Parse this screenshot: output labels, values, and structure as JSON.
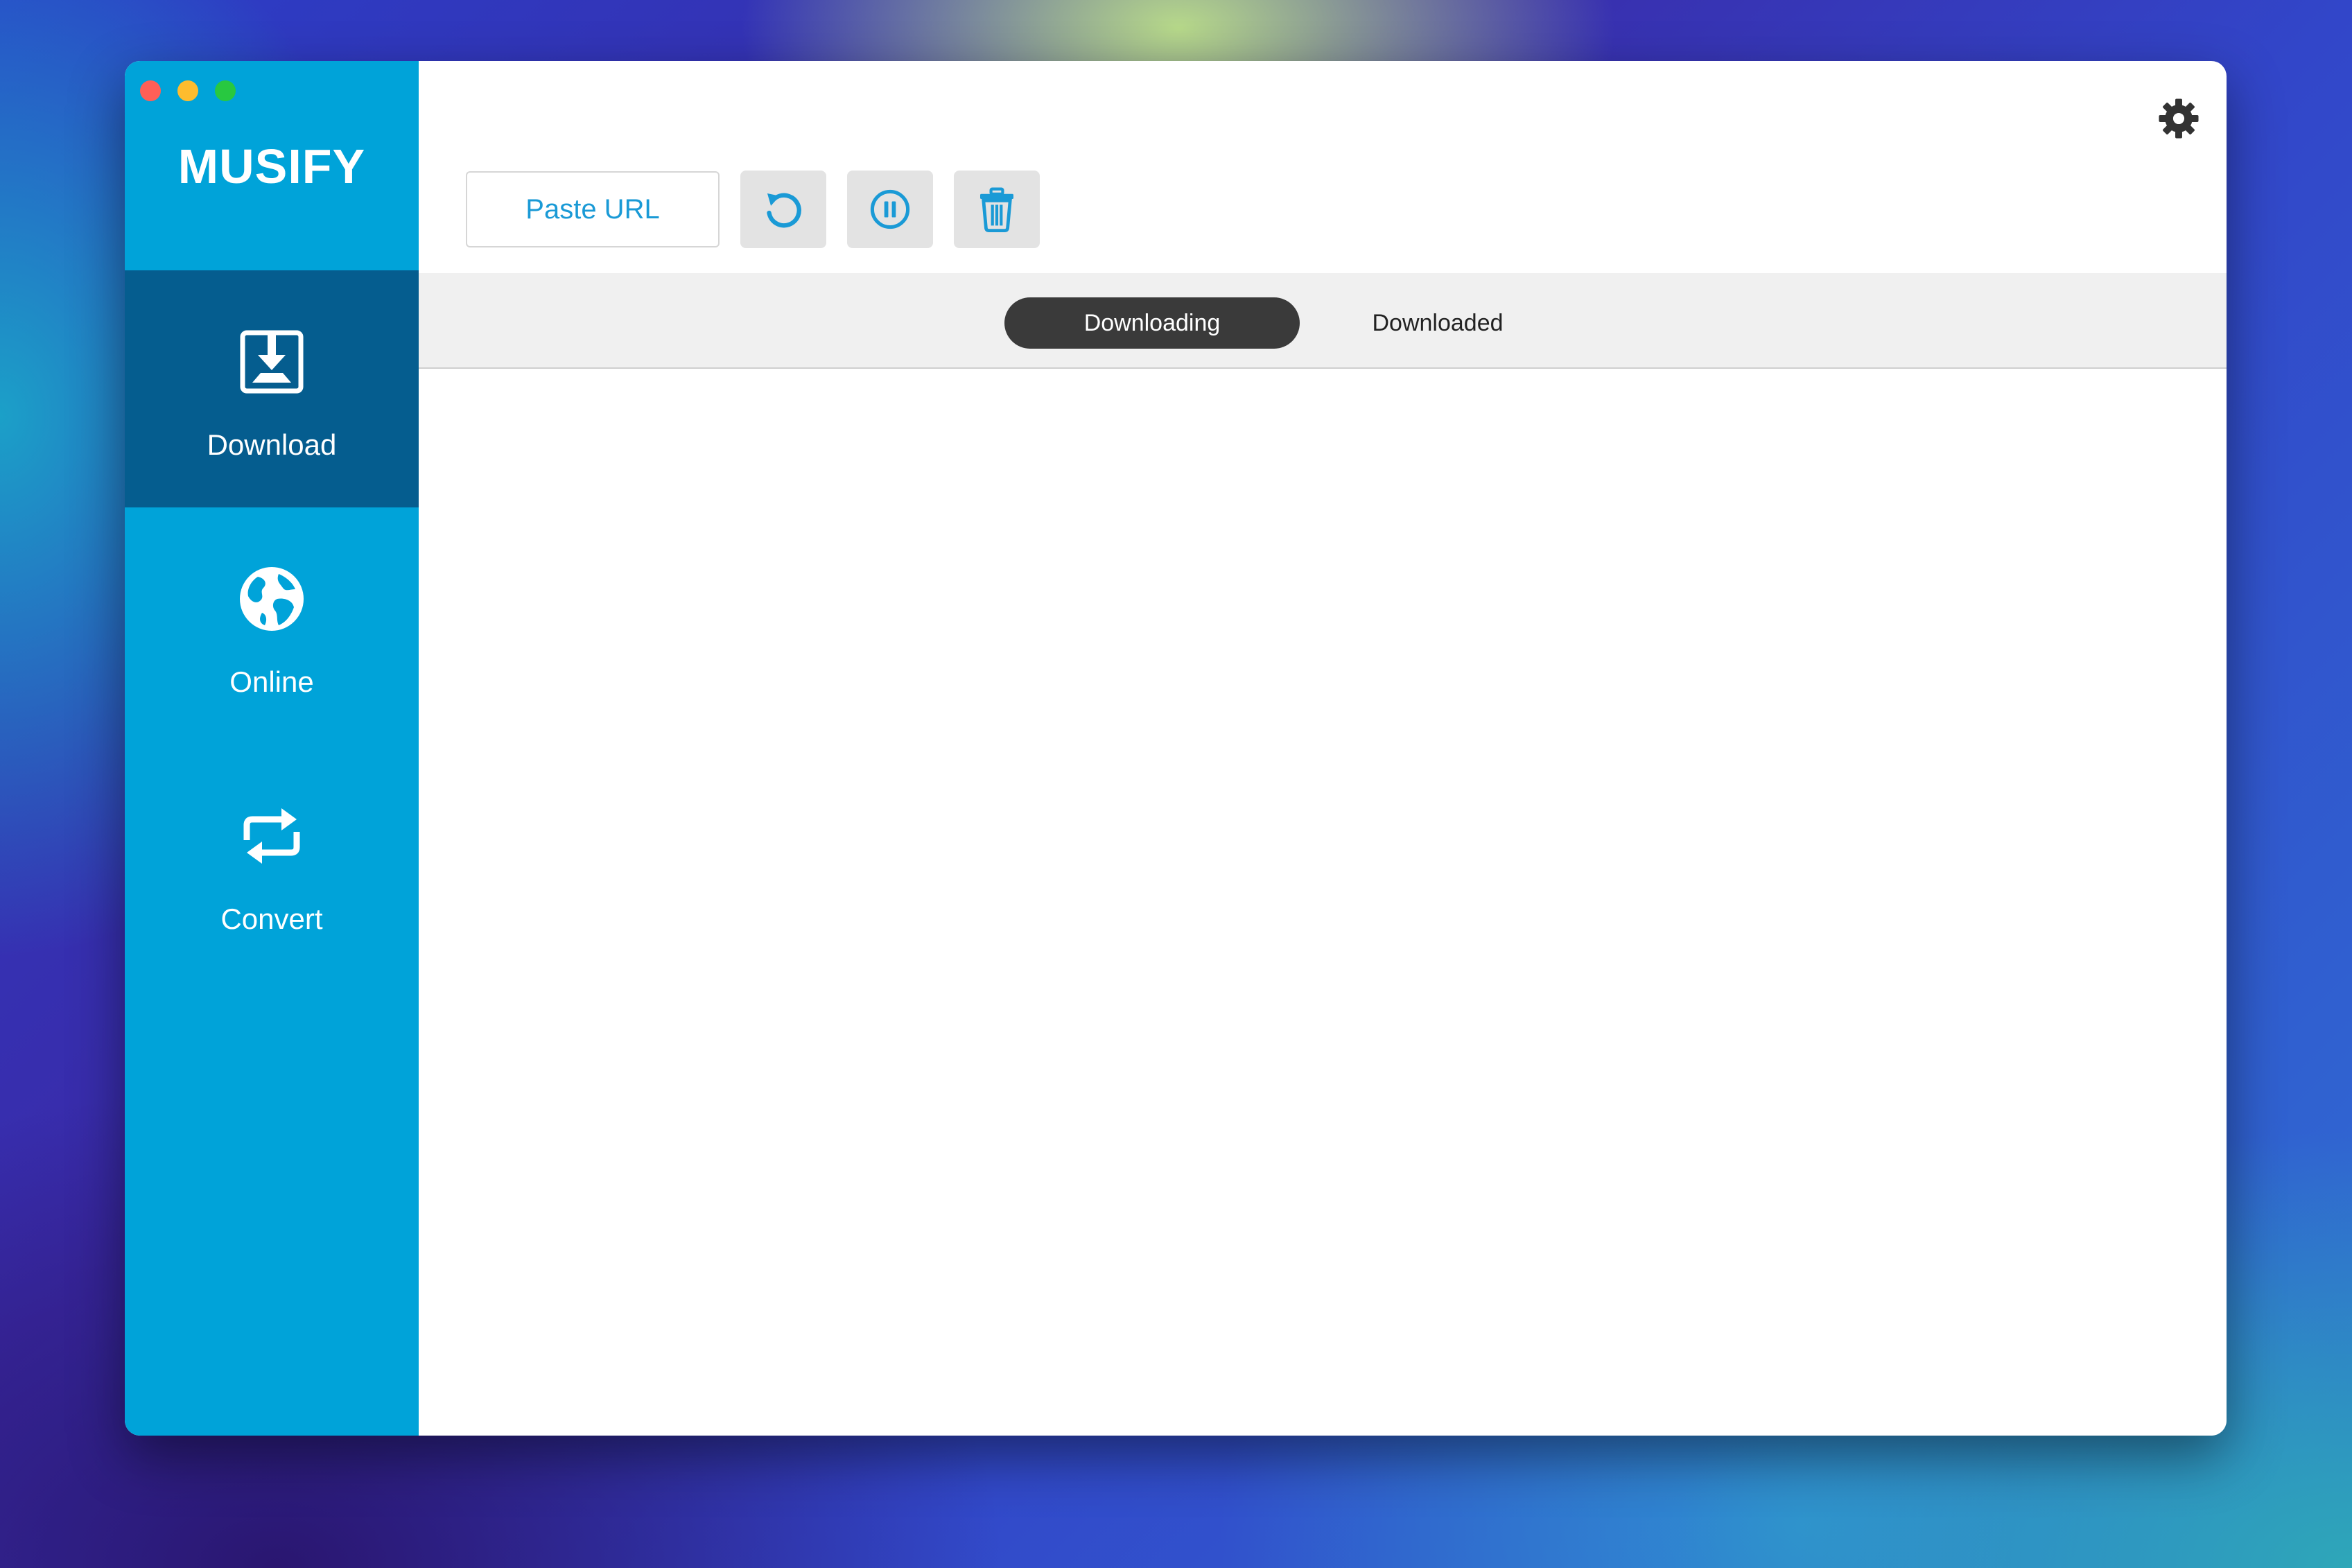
{
  "app": {
    "name": "MUSIFY"
  },
  "sidebar": {
    "items": [
      {
        "label": "Download",
        "icon": "download-icon",
        "active": true
      },
      {
        "label": "Online",
        "icon": "globe-icon",
        "active": false
      },
      {
        "label": "Convert",
        "icon": "convert-icon",
        "active": false
      }
    ]
  },
  "toolbar": {
    "paste_url_label": "Paste URL",
    "buttons": [
      "refresh-icon",
      "pause-icon",
      "trash-icon"
    ]
  },
  "tabs": [
    {
      "label": "Downloading",
      "active": true
    },
    {
      "label": "Downloaded",
      "active": false
    }
  ],
  "colors": {
    "sidebar": "#00a3d9",
    "sidebar_active": "#055d8f",
    "accent": "#1a9ad6",
    "tab_active": "#3a3a3a"
  }
}
